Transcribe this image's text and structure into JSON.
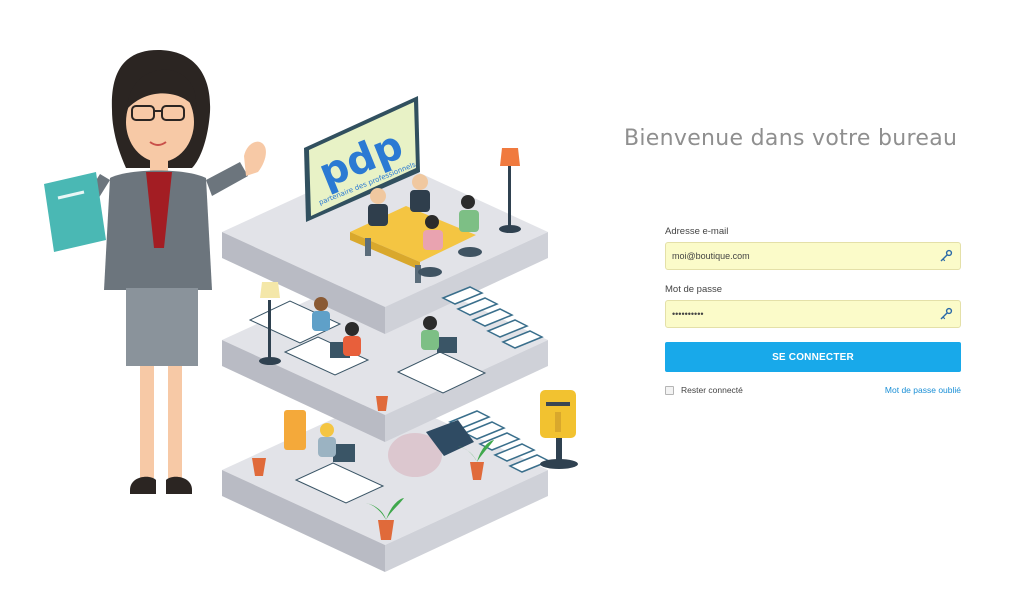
{
  "page": {
    "welcome_title": "Bienvenue dans votre bureau"
  },
  "illustration": {
    "logo_text": "pdp",
    "logo_tagline": "partenaire des professionnels"
  },
  "login": {
    "email_label": "Adresse e-mail",
    "email_value": "moi@boutique.com",
    "password_label": "Mot de passe",
    "password_value": "••••••••••",
    "submit_label": "SE CONNECTER",
    "remember_label": "Rester connecté",
    "forgot_label": "Mot de passe oublié"
  },
  "colors": {
    "accent": "#18a9ea",
    "field_bg": "#fbfbc9",
    "link": "#1a8fd6",
    "title": "#8f8f8f"
  }
}
